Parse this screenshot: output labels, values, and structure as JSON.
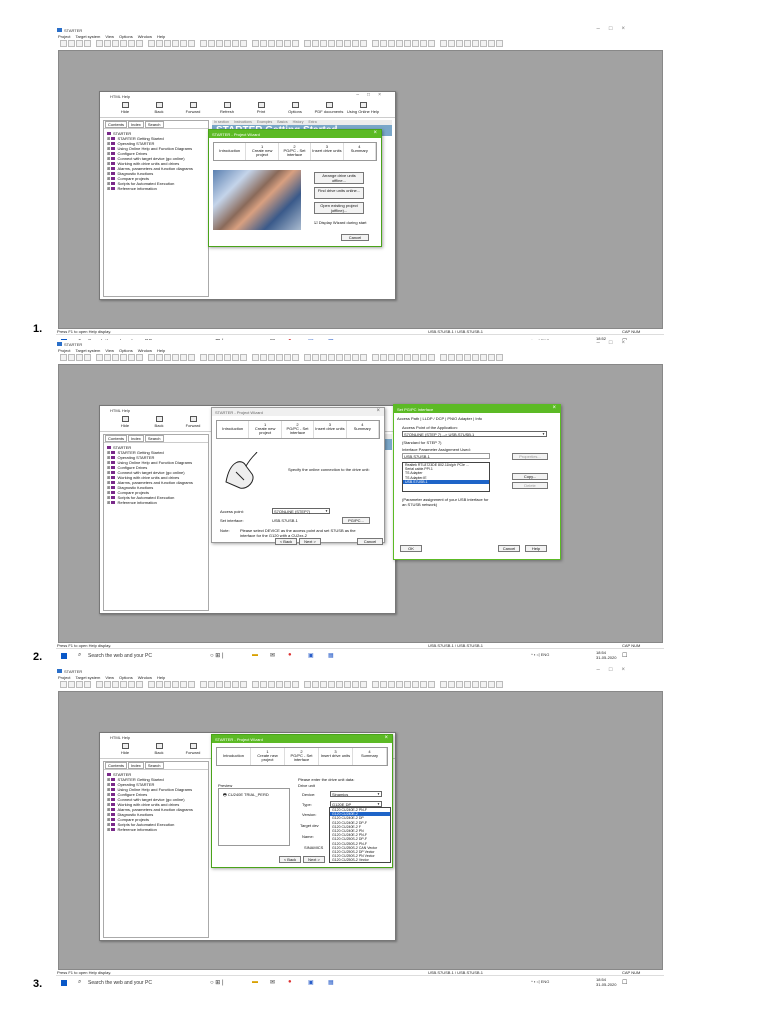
{
  "panels": [
    {
      "number": "1."
    },
    {
      "number": "2."
    },
    {
      "number": "3."
    }
  ],
  "app": {
    "title": "STARTER",
    "menu": [
      "Project",
      "Target system",
      "View",
      "Options",
      "Window",
      "Help"
    ],
    "status": "Press F1 to open Help display.",
    "status_device": "USB.S7USB.1 / USB.S7USB.1",
    "status_caps": "CAP  NUM"
  },
  "taskbar": {
    "search_placeholder": "Search the web and your PC",
    "lang": "ENG",
    "clocks": [
      {
        "time": "18:52",
        "date": "31-05-2020"
      },
      {
        "time": "18:54",
        "date": "31-05-2020"
      },
      {
        "time": "18:54",
        "date": "31-05-2020"
      }
    ]
  },
  "help": {
    "title": "HTML Help",
    "toolbar": [
      "Hide",
      "Back",
      "Forward",
      "Refresh",
      "Print",
      "Options",
      "PDF documents",
      "Using Online Help"
    ],
    "tabs": [
      "Contents",
      "Index",
      "Search"
    ],
    "tree": [
      "STARTER",
      "STARTER Getting Started",
      "Operating STARTER",
      "Using Online Help and Function Diagrams",
      "Configure Drives",
      "Connect with target device (go online)",
      "Working with drive units and drives",
      "Alarms, parameters and function diagrams",
      "Diagnostic functions",
      "Compare projects",
      "Scripts for Automated Execution",
      "Reference information"
    ],
    "nav": [
      "In section",
      "Instructions",
      "Examples",
      "Basics",
      "History",
      "Extra"
    ],
    "heading": "STARTER Getting Started"
  },
  "wizard": {
    "title": "STARTER - Project Wizard",
    "steps": [
      {
        "n": "",
        "label": "Introduction"
      },
      {
        "n": "1",
        "label": "Create new project"
      },
      {
        "n": "2",
        "label": "PG/PC - Set interface"
      },
      {
        "n": "3",
        "label": "Insert drive units"
      },
      {
        "n": "4",
        "label": "Summary"
      }
    ],
    "p1": {
      "buttons": [
        "Arrange drive units offline...",
        "Find drive units online...",
        "Open existing project (offline)..."
      ],
      "checkbox_label": "Display Wizard during start",
      "cancel": "Cancel"
    },
    "p2": {
      "instruction": "Specify the online connection to the drive unit:",
      "access_point_label": "Access point:",
      "access_point_value": "S7ONLINE (STEP7)",
      "interface_label": "Set interface:",
      "interface_value": "USB.S7USB.1",
      "pgpc_button": "PG/PC...",
      "note_label": "Note:",
      "note_text": "Please select DEVICE as the access point and set S7USB as the interface for the G120 with a CU2xx-2",
      "back": "< Back",
      "next": "Next >",
      "cancel": "Cancel"
    },
    "p3": {
      "preview_label": "Preview",
      "preview_item": "CU240E TRIAL_PERD",
      "prompt": "Please enter the drive unit data:",
      "drive_unit": "Drive unit",
      "device_label": "Device:",
      "device_value": "Sinamics",
      "type_label": "Type:",
      "type_value": "G120E DP",
      "version_label": "Version:",
      "target_label": "Target dev",
      "name_label": "Name:",
      "sinamics_label": "SINAMICS",
      "back": "< Back",
      "next": "Next >",
      "type_options": [
        "G120 CU240E-2 PN-F",
        "G120 CU240E-2",
        "G120 CU240E-2 DP",
        "G120 CU240E-2 DP-F",
        "G120 CU240E-2 F",
        "G120 CU240E-2 PN",
        "G120 CU240E-2 PN-F",
        "G120 CU250S-2 DP-F",
        "G120 CU250S-2 PN-F",
        "G120 CU250S-2 CAN Vector",
        "G120 CU250S-2 DP Vector",
        "G120 CU250S-2 PN Vector",
        "G120 CU250S-2 Vector"
      ]
    }
  },
  "pgpc": {
    "title": "Set PG/PC Interface",
    "tabs": [
      "Access Path",
      "LLDP / DCP",
      "PNIO Adapter",
      "Info"
    ],
    "app_label": "Access Point of the Application:",
    "app_value": "S7ONLINE (STEP 7)   --> USB.S7USB.1",
    "std_label": "(Standard for STEP 7)",
    "iface_label": "Interface Parameter Assignment Used:",
    "iface_value": "USB.S7USB.1",
    "properties": "Properties...",
    "list": [
      "Realtek RTL8723DE 802.11b/g/n PCIe ...",
      "Serial cable.PPI.1",
      "TS Adapter",
      "TS Adapter.IE",
      "USB.S7USB.1"
    ],
    "copy": "Copy...",
    "delete": "Delete",
    "desc": "(Parameter assignment of your USB interface for an S7USB network)",
    "ok": "OK",
    "cancel": "Cancel",
    "help": "Help"
  }
}
